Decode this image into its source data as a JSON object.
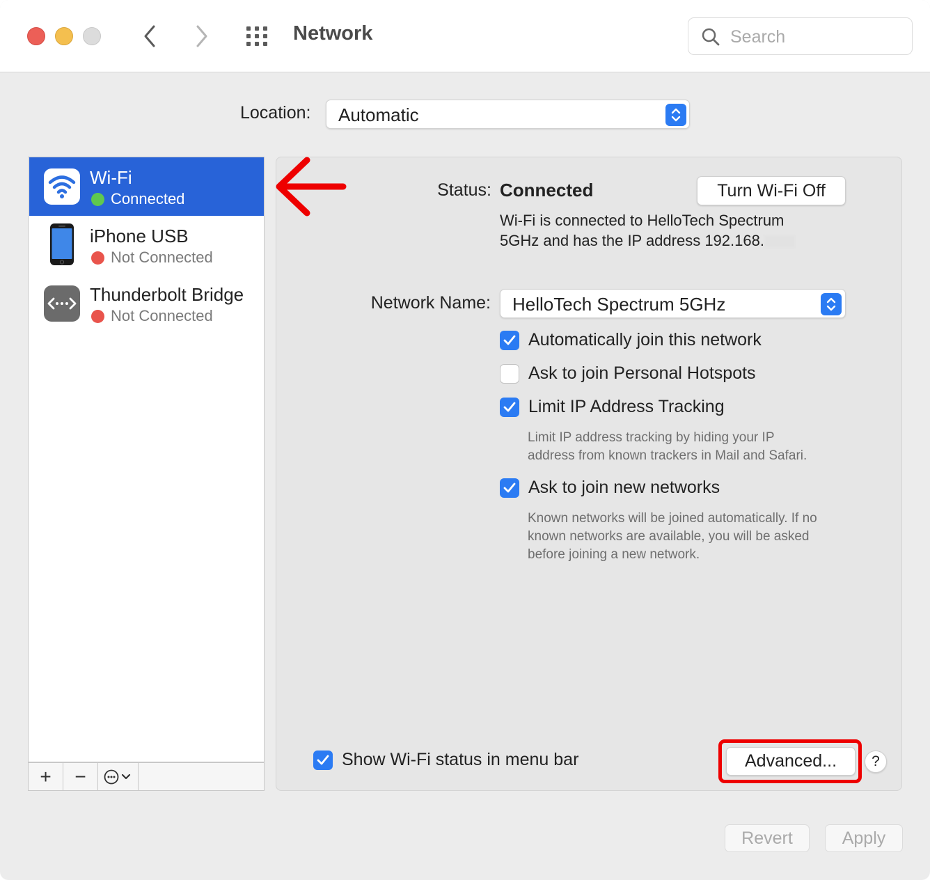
{
  "window": {
    "title": "Network",
    "search_placeholder": "Search"
  },
  "location": {
    "label": "Location:",
    "value": "Automatic"
  },
  "services": [
    {
      "name": "Wi-Fi",
      "status": "Connected",
      "status_color": "#5fc84f",
      "selected": true,
      "icon": "wifi-icon"
    },
    {
      "name": "iPhone USB",
      "status": "Not Connected",
      "status_color": "#e9544c",
      "selected": false,
      "icon": "iphone-icon"
    },
    {
      "name": "Thunderbolt Bridge",
      "status": "Not Connected",
      "status_color": "#e9544c",
      "selected": false,
      "icon": "thunderbolt-bridge-icon"
    }
  ],
  "sidebar_toolbar": {
    "add": "+",
    "remove": "−"
  },
  "detail": {
    "status_label": "Status:",
    "status_value": "Connected",
    "toggle_button": "Turn Wi-Fi Off",
    "status_desc_line1": "Wi-Fi is connected to HelloTech Spectrum",
    "status_desc_line2": "5GHz and has the IP address 192.168.",
    "network_name_label": "Network Name:",
    "network_name_value": "HelloTech Spectrum 5GHz",
    "options": [
      {
        "label": "Automatically join this network",
        "checked": true
      },
      {
        "label": "Ask to join Personal Hotspots",
        "checked": false
      },
      {
        "label": "Limit IP Address Tracking",
        "checked": true
      },
      {
        "label": "Ask to join new networks",
        "checked": true
      }
    ],
    "limit_ip_note_line1": "Limit IP address tracking by hiding your IP",
    "limit_ip_note_line2": "address from known trackers in Mail and Safari.",
    "new_networks_note_line1": "Known networks will be joined automatically. If no",
    "new_networks_note_line2": "known networks are available, you will be asked",
    "new_networks_note_line3": "before joining a new network.",
    "show_status_label": "Show Wi-Fi status in menu bar",
    "show_status_checked": true,
    "advanced_button": "Advanced...",
    "help_button": "?"
  },
  "footer": {
    "revert": "Revert",
    "apply": "Apply"
  },
  "colors": {
    "accent": "#2b7bf3",
    "selection": "#2863d8",
    "annotation": "#ee0000"
  }
}
